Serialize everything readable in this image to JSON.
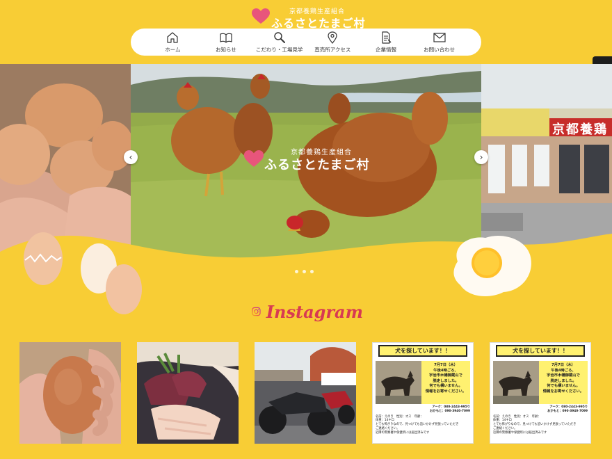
{
  "header": {
    "logo_subtitle": "京都養鶏生産組合",
    "logo_title": "ふるさとたまご村"
  },
  "nav": [
    {
      "label": "ホーム",
      "icon": "home-icon"
    },
    {
      "label": "お知らせ",
      "icon": "book-icon"
    },
    {
      "label": "こだわり・工場見学",
      "icon": "search-icon"
    },
    {
      "label": "直売所アクセス",
      "icon": "map-pin-icon"
    },
    {
      "label": "企業情報",
      "icon": "document-icon"
    },
    {
      "label": "お問い合わせ",
      "icon": "mail-icon"
    }
  ],
  "social": [
    {
      "icon": "twitter-icon"
    },
    {
      "icon": "instagram-icon"
    }
  ],
  "hero": {
    "logo_subtitle": "京都養鶏生産組合",
    "logo_title": "ふるさとたまご村",
    "store_sign": "京都養鶏",
    "slide_count": 3,
    "active_slide": 1
  },
  "instagram": {
    "title": "Instagram"
  },
  "poster": {
    "heading": "犬を探しています！！",
    "info_lines": [
      "7月7日（木）",
      "午後4時ごろ、",
      "宇治市木幡御蔵山で",
      "脱走しました。",
      "何でも構いません。",
      "情報をお寄せください。"
    ],
    "contact_lines": [
      "アーク：080-2443-995り",
      "おかもと：090-3940-7099"
    ],
    "details": [
      "名前：えのき　性別：オス　年齢：",
      "体重：14キロ",
      "とても怖がりなので、見つけても追いかけず見張っていただき",
      "ご連絡ください。",
      "近隣の警察署や保健所には届出済みです"
    ]
  },
  "colors": {
    "background": "#f8cd35",
    "accent_pink": "#e8557b",
    "instagram_text": "#d83a52"
  }
}
